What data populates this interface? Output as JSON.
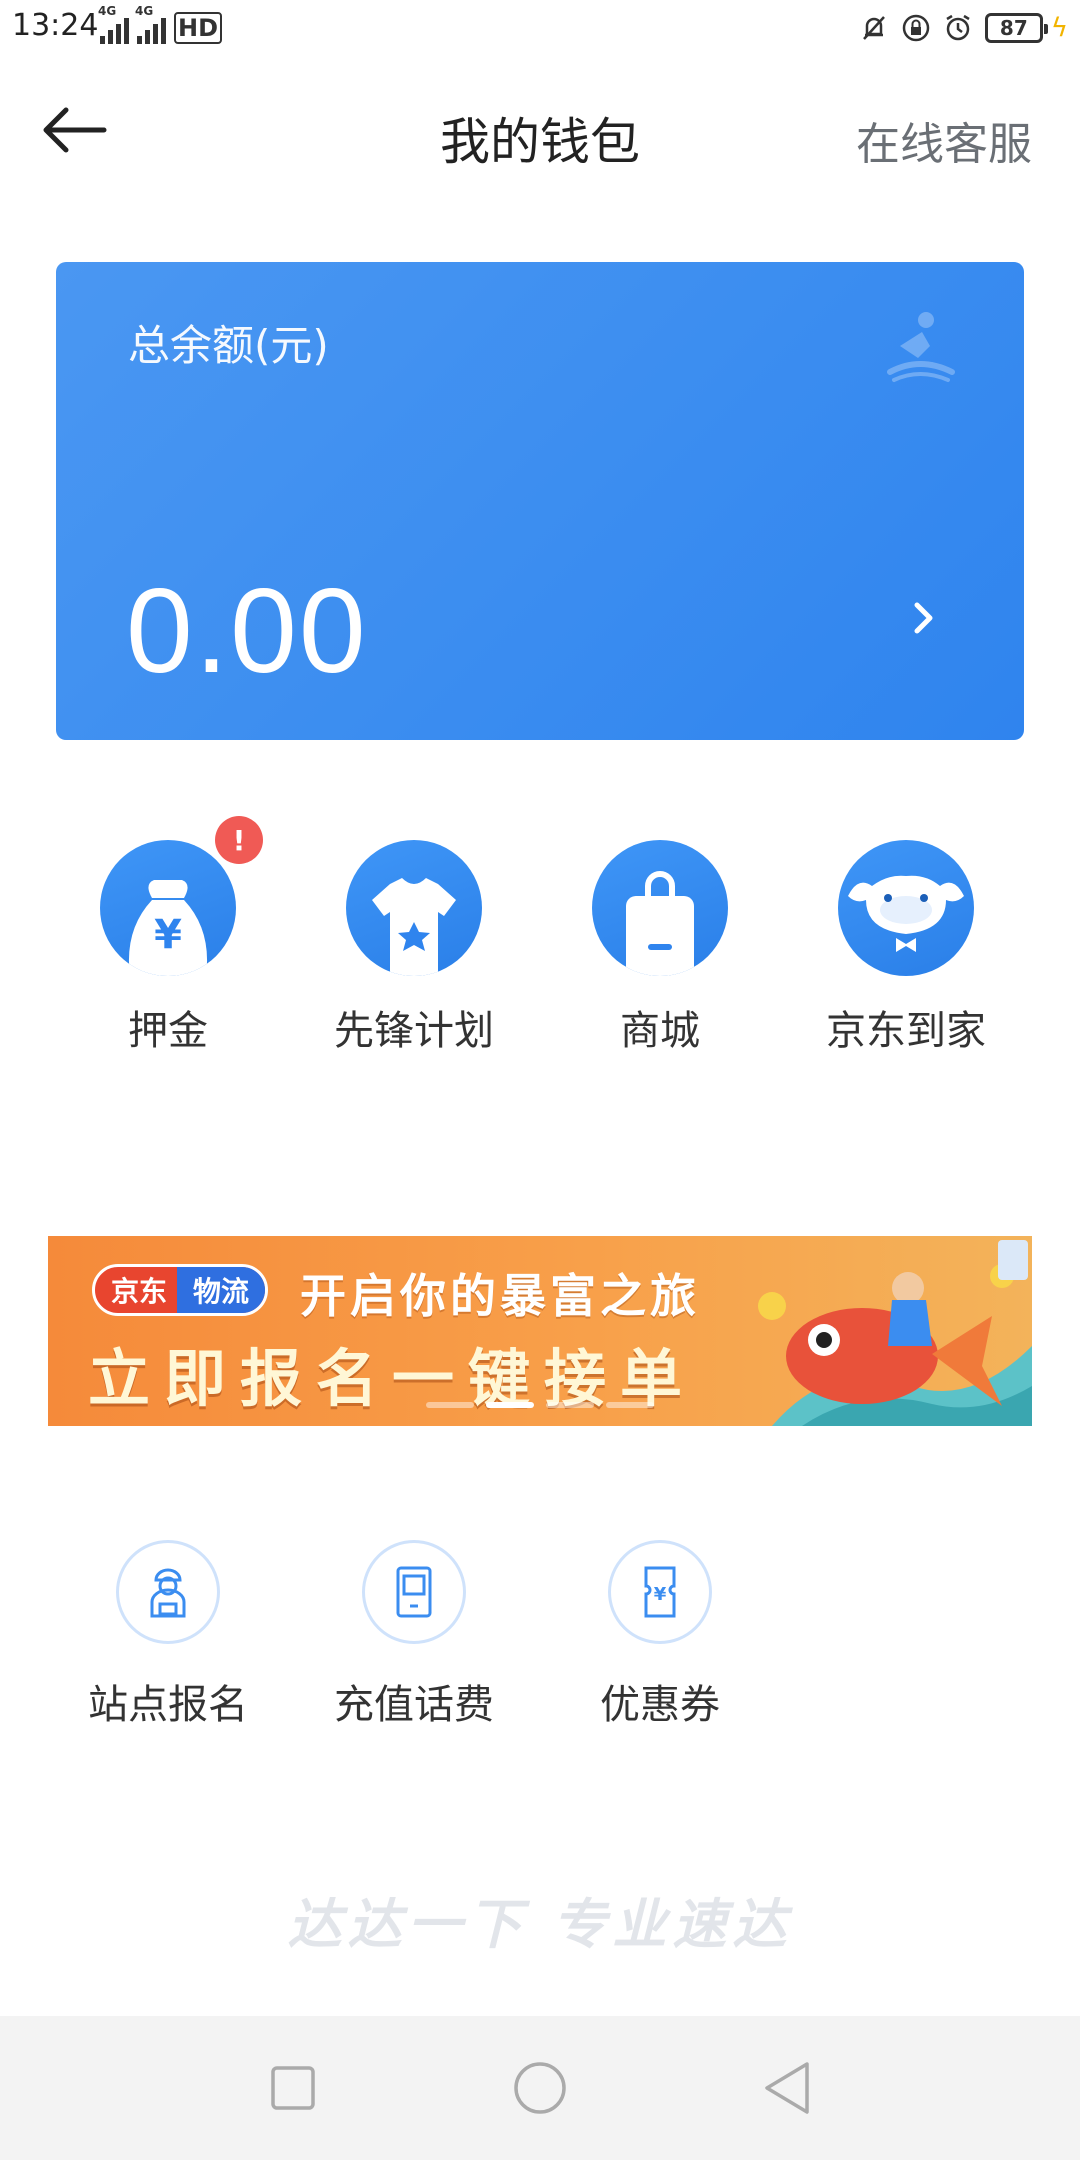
{
  "status_bar": {
    "time": "13:24",
    "network_tags": [
      "4G",
      "4G"
    ],
    "hd_label": "HD",
    "battery": "87"
  },
  "nav": {
    "back_icon": "arrow-left-icon",
    "title": "我的钱包",
    "service_label": "在线客服"
  },
  "balance": {
    "label": "总余额(元)",
    "amount": "0.00",
    "colors": {
      "card": "#3b8df0"
    }
  },
  "services": [
    {
      "label": "押金",
      "icon": "money-bag-icon",
      "badge": "!"
    },
    {
      "label": "先锋计划",
      "icon": "tshirt-icon"
    },
    {
      "label": "商城",
      "icon": "shopping-bag-icon"
    },
    {
      "label": "京东到家",
      "icon": "jd-dog-icon"
    }
  ],
  "banner": {
    "brand_a": "京东",
    "brand_b": "物流",
    "line1": "开启你的暴富之旅",
    "line2": "立即报名一键接单",
    "active_slide": 2,
    "slide_count": 4
  },
  "tools": [
    {
      "label": "站点报名",
      "icon": "courier-icon"
    },
    {
      "label": "充值话费",
      "icon": "phone-icon"
    },
    {
      "label": "优惠券",
      "icon": "coupon-icon"
    }
  ],
  "slogan": "达达一下 专业速达",
  "accent": "#3b8df0",
  "alert_color": "#f05a55"
}
